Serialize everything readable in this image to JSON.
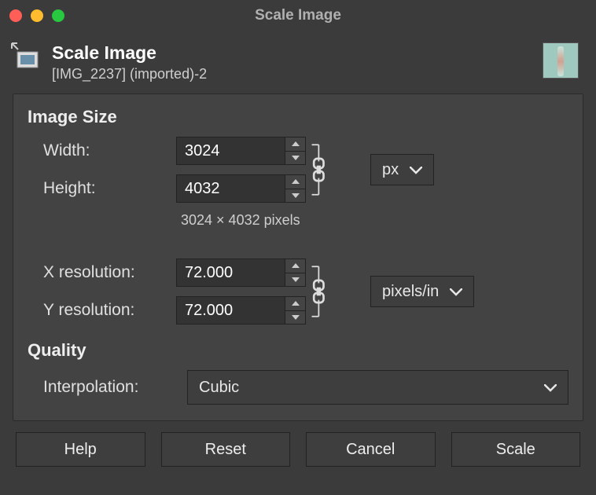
{
  "window": {
    "title": "Scale Image"
  },
  "header": {
    "title": "Scale Image",
    "subtitle": "[IMG_2237] (imported)-2"
  },
  "sections": {
    "image_size": {
      "title": "Image Size",
      "width_label": "Width:",
      "width_value": "3024",
      "height_label": "Height:",
      "height_value": "4032",
      "dimensions_text": "3024 × 4032 pixels",
      "unit": "px",
      "xres_label": "X resolution:",
      "xres_value": "72.000",
      "yres_label": "Y resolution:",
      "yres_value": "72.000",
      "res_unit": "pixels/in"
    },
    "quality": {
      "title": "Quality",
      "interpolation_label": "Interpolation:",
      "interpolation_value": "Cubic"
    }
  },
  "buttons": {
    "help": "Help",
    "reset": "Reset",
    "cancel": "Cancel",
    "scale": "Scale"
  }
}
